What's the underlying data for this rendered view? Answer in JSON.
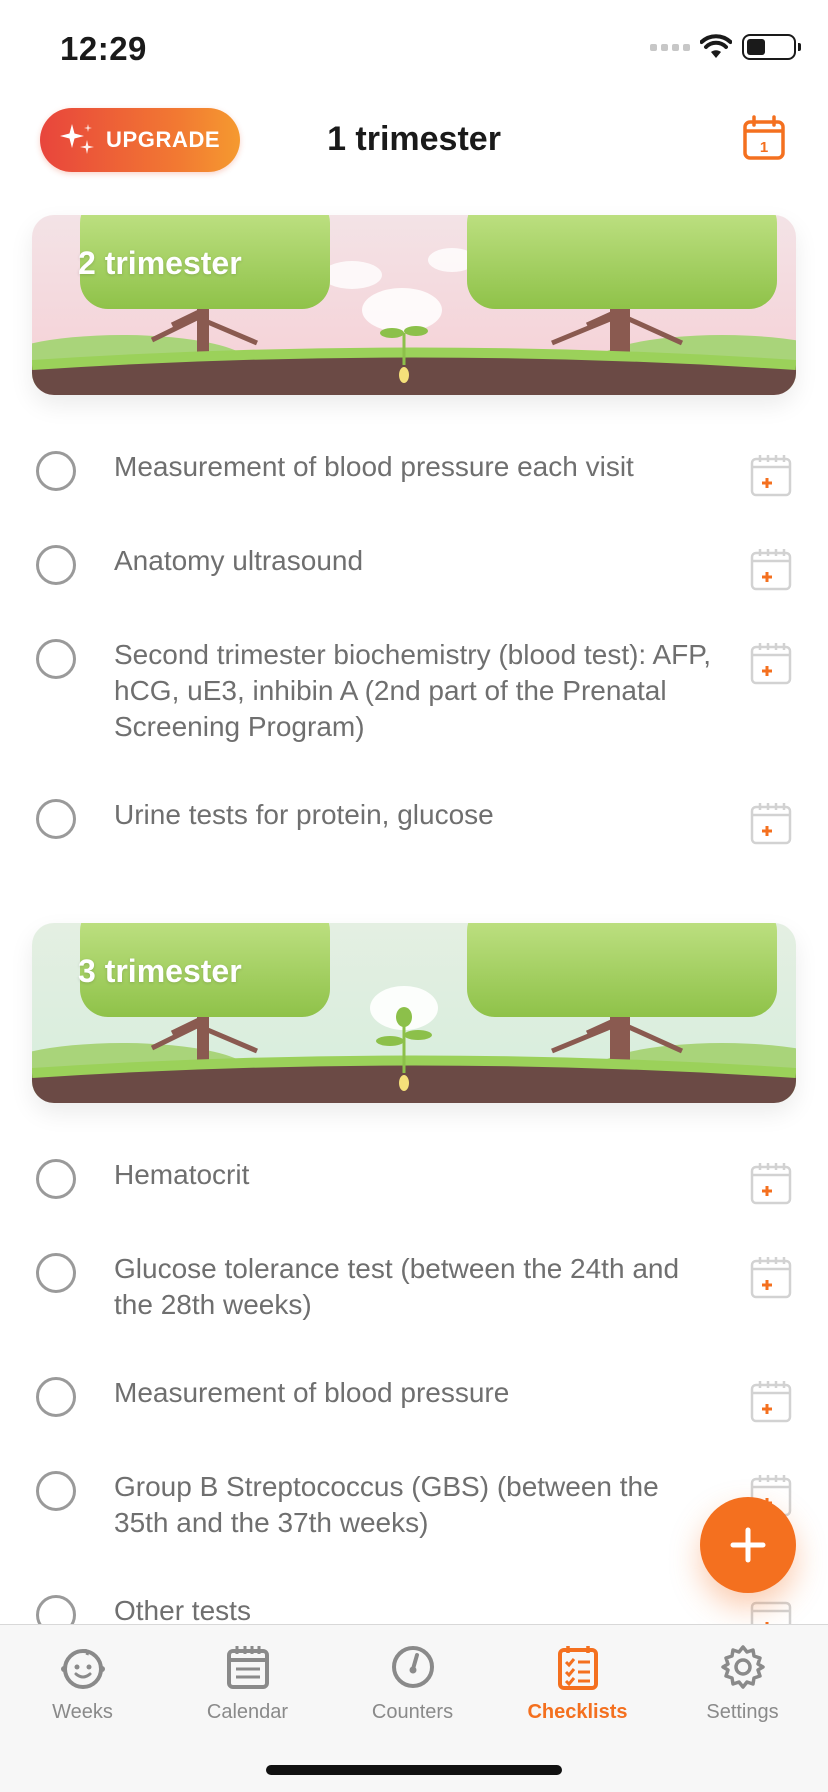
{
  "status_bar": {
    "time": "12:29"
  },
  "header": {
    "upgrade_label": "UPGRADE",
    "title": "1 trimester"
  },
  "sections": [
    {
      "title": "2 trimester",
      "items": [
        "Measurement of blood pressure each visit",
        "Anatomy ultrasound",
        "Second trimester biochemistry (blood test): AFP, hCG, uE3, inhibin A (2nd part of the Prenatal Screening Program)",
        "Urine tests for protein, glucose"
      ]
    },
    {
      "title": "3 trimester",
      "items": [
        "Hematocrit",
        "Glucose tolerance test (between the 24th and the 28th weeks)",
        "Measurement of blood pressure",
        "Group B Streptococcus (GBS) (between the 35th and the 37th weeks)",
        "Other tests"
      ]
    }
  ],
  "tabs": [
    {
      "label": "Weeks",
      "icon": "baby-face-icon"
    },
    {
      "label": "Calendar",
      "icon": "calendar-icon"
    },
    {
      "label": "Counters",
      "icon": "stopwatch-icon"
    },
    {
      "label": "Checklists",
      "icon": "checklist-icon",
      "active": true
    },
    {
      "label": "Settings",
      "icon": "gear-icon"
    }
  ],
  "colors": {
    "accent": "#f4701f",
    "upgrade_start": "#e8453c",
    "upgrade_end": "#f59a30",
    "checkbox": "#9a9a9a",
    "item_text": "#6f6f6f"
  }
}
